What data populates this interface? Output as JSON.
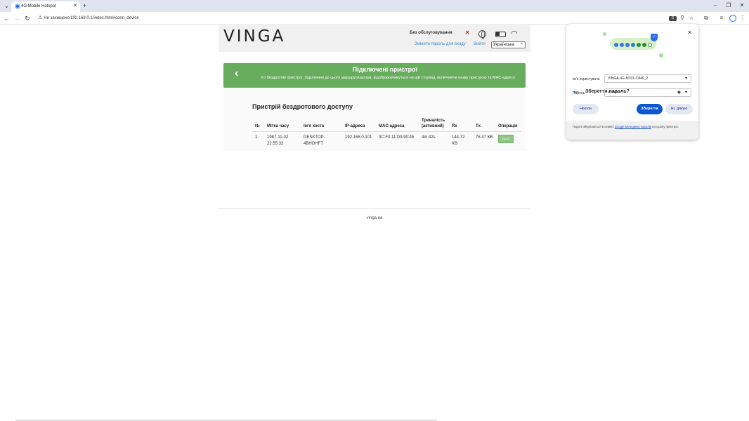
{
  "browser": {
    "tab_title": "4G Mobile Hotspot",
    "tab_close": "✕",
    "new_tab": "+",
    "security_label": "Не захищено",
    "url": "192.168.0.1/index.html#conn_device",
    "minimize": "–",
    "restore": "❐",
    "close": "✕"
  },
  "header": {
    "logo": "VINGA",
    "service_status": "Без обслуговування",
    "service_x": "✕",
    "change_password": "Змінити пароль для входу",
    "logout": "Вийти",
    "language": "Українська"
  },
  "banner": {
    "back": "‹",
    "title": "Підключені пристрої",
    "description": "Усі бездротові пристрої, підключені до цього маршрутизатора, відображатимуться на цій сторінці, включаючи назву пристрою та MAC-адресу"
  },
  "section": {
    "title": "Пристрій бездротового доступу",
    "columns": [
      "№",
      "Мітка часу",
      "Ім'я хоста",
      "IP-адреса",
      "MAC-адреса",
      "Тривалість (активний)",
      "Rx",
      "Tx",
      "Операція"
    ],
    "rows": [
      {
        "no": "1",
        "timestamp": "1987-11-02 22:55:32",
        "host": "DESKTOP-4BHOHFT",
        "ip": "192.168.0.101",
        "mac": "3C:F0:11:D9:90:45",
        "duration": "4m:42s",
        "rx": "144.72 KB",
        "tx": "76.47 KB",
        "op": "Block"
      }
    ]
  },
  "footer": {
    "text": "vinga.ua"
  },
  "save_password": {
    "close": "✕",
    "title": "Зберегти пароль?",
    "username_label": "Ім'я користувача",
    "username_value": "VINGA-4G-M101-C846_2",
    "password_label": "Пароль",
    "password_value": "••••••••••",
    "never": "Ніколи",
    "save": "Зберегти",
    "no_thanks": "Ні, дякую",
    "footer_text_1": "Паролі зберігаються в сервісі ",
    "footer_link": "Google Менеджер паролів",
    "footer_text_2": " на цьому пристрої."
  },
  "colors": {
    "banner_green": "#68ad5e",
    "link_blue": "#3a84c8",
    "save_blue": "#0b57d0"
  }
}
